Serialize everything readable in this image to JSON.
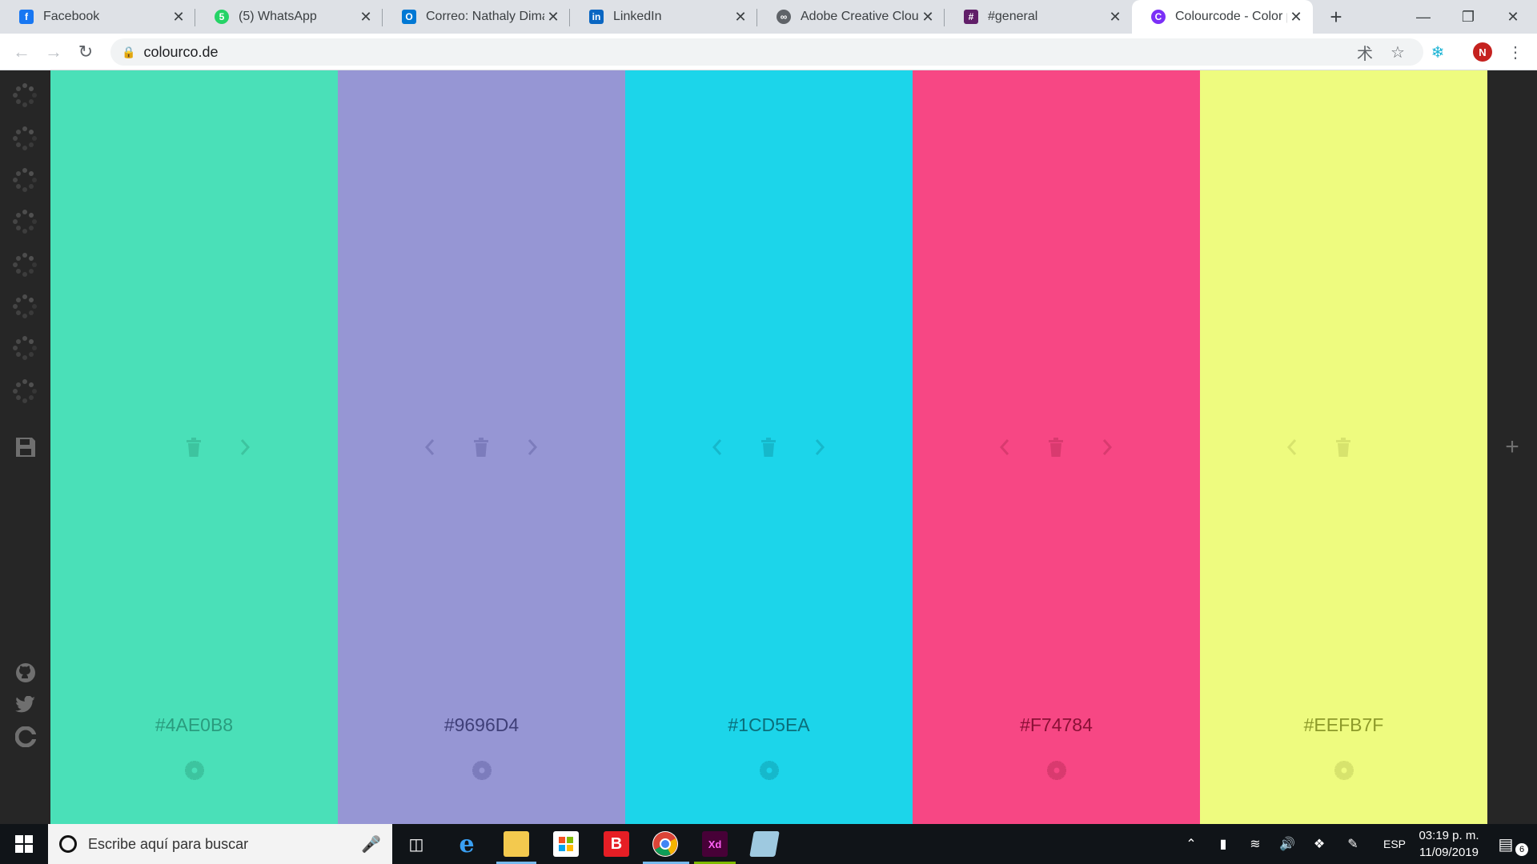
{
  "browser": {
    "tabs": [
      {
        "title": "Facebook",
        "icon": "facebook-icon",
        "color": "#1877f2"
      },
      {
        "title": "(5) WhatsApp",
        "icon": "whatsapp-icon",
        "color": "#25d366"
      },
      {
        "title": "Correo: Nathaly Dimas",
        "icon": "outlook-icon",
        "color": "#0078d4"
      },
      {
        "title": "LinkedIn",
        "icon": "linkedin-icon",
        "color": "#0a66c2"
      },
      {
        "title": "Adobe Creative Cloud",
        "icon": "creative-cloud-icon",
        "color": "#5f6368"
      },
      {
        "title": "#general",
        "icon": "slack-icon",
        "color": "#611f69"
      },
      {
        "title": "Colourcode - Color palette generator",
        "icon": "colourcode-icon",
        "color": "#7b2ff7",
        "active": true
      }
    ],
    "url": "colourco.de",
    "profile_initial": "N"
  },
  "palette": {
    "colors": [
      {
        "hex": "#4AE0B8",
        "bg": "#4ae0b8",
        "fg": "#2a9c7e",
        "icon_fg": "#3dc49f",
        "left_arrow": false,
        "right_arrow": true
      },
      {
        "hex": "#9696D4",
        "bg": "#9696d4",
        "fg": "#3f3f78",
        "icon_fg": "#7c7cbc",
        "left_arrow": true,
        "right_arrow": true
      },
      {
        "hex": "#1CD5EA",
        "bg": "#1cd5ea",
        "fg": "#0b6e7a",
        "icon_fg": "#16b8cb",
        "left_arrow": true,
        "right_arrow": true
      },
      {
        "hex": "#F74784",
        "bg": "#f74784",
        "fg": "#8a1036",
        "icon_fg": "#d93a6f",
        "left_arrow": true,
        "right_arrow": true
      },
      {
        "hex": "#EEFB7F",
        "bg": "#eefb7f",
        "fg": "#8d9a2a",
        "icon_fg": "#d7e36d",
        "left_arrow": true,
        "right_arrow": false
      }
    ]
  },
  "taskbar": {
    "search_placeholder": "Escribe aquí para buscar",
    "language": "ESP",
    "time": "03:19 p. m.",
    "date": "11/09/2019",
    "notifications": "6"
  }
}
